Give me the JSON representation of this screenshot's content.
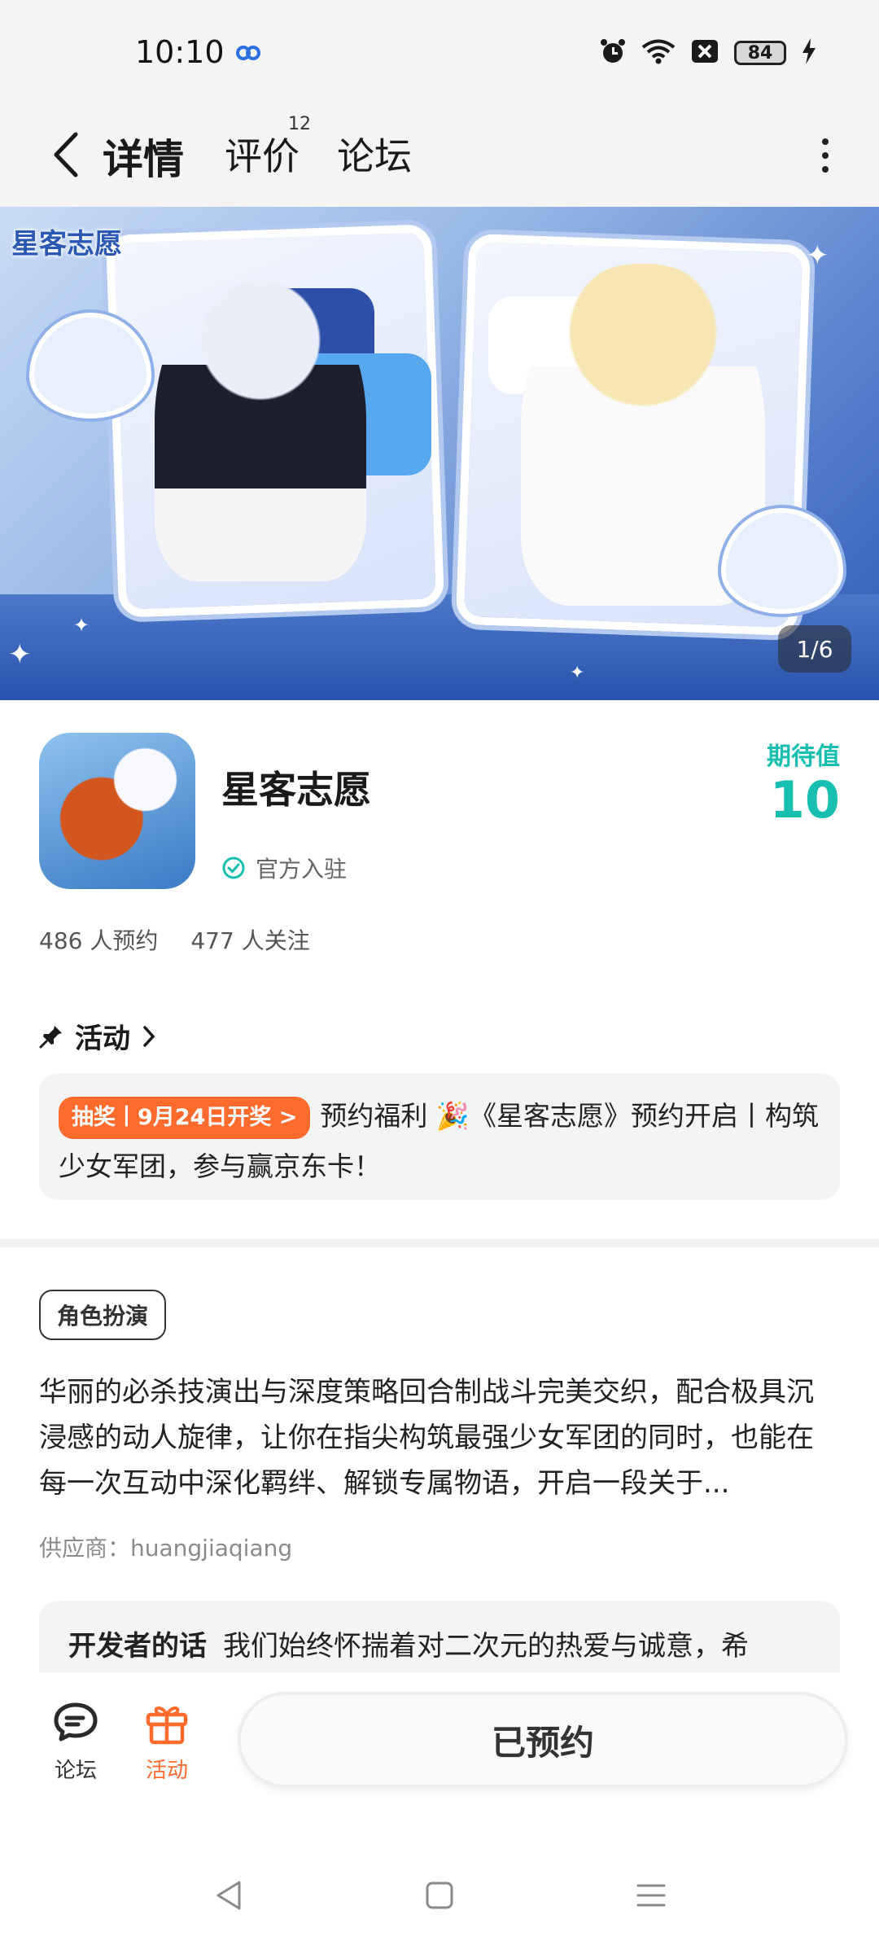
{
  "status_bar": {
    "time": "10:10",
    "battery": "84",
    "icons": [
      "cloud-link-icon",
      "alarm-icon",
      "wifi-icon",
      "sim-blocked-icon",
      "battery-icon",
      "charging-icon"
    ]
  },
  "nav": {
    "tabs": [
      {
        "label": "详情",
        "active": true
      },
      {
        "label": "评价",
        "badge": "12"
      },
      {
        "label": "论坛"
      }
    ],
    "accent_color": "#2cd4c4"
  },
  "banner": {
    "logo_text": "星客志愿",
    "page_indicator": "1/6"
  },
  "game": {
    "title": "星客志愿",
    "official_label": "官方入驻",
    "expect_label": "期待值",
    "expect_value": "10",
    "reservations": "486 人预约",
    "followers": "477 人关注"
  },
  "activity": {
    "header": "活动",
    "tag": "抽奖丨9月24日开奖 >",
    "text": "预约福利 🎉《星客志愿》预约开启丨构筑少女军团，参与赢京东卡！",
    "tag_color": "#ff6b2c"
  },
  "details": {
    "genre": "角色扮演",
    "description": "华丽的必杀技演出与深度策略回合制战斗完美交织，配合极具沉浸感的动人旋律，让你在指尖构筑最强少女军团的同时，也能在每一次互动中深化羁绊、解锁专属物语，开启一段关于...",
    "supplier": "供应商：huangjiaqiang",
    "dev_words_label": "开发者的话",
    "dev_words_text": "我们始终怀揣着对二次元的热爱与诚意，希"
  },
  "bottom_bar": {
    "forum_label": "论坛",
    "activity_label": "活动",
    "reserved_label": "已预约"
  }
}
